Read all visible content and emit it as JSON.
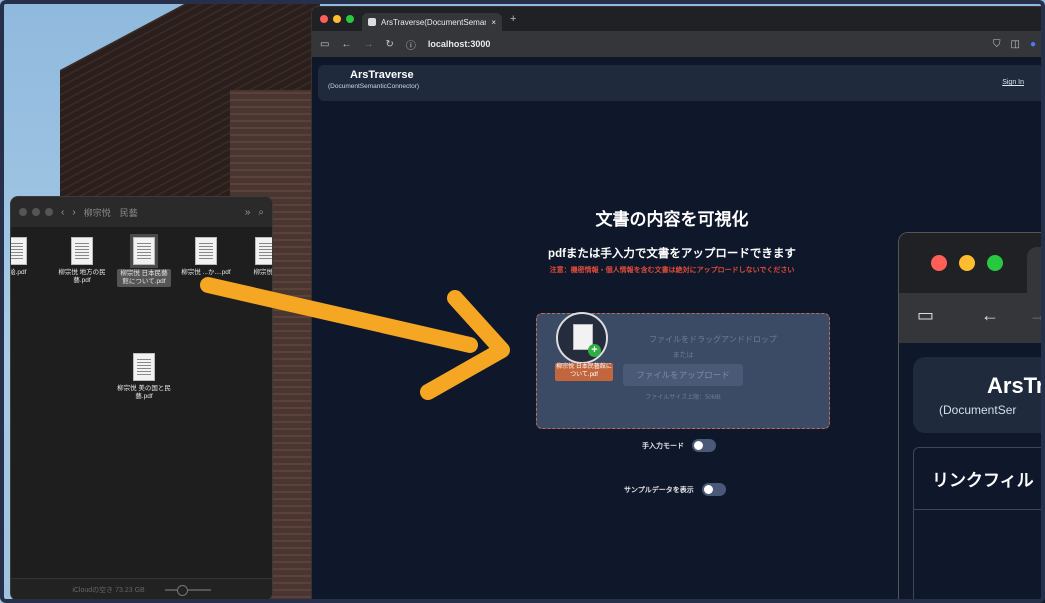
{
  "finder": {
    "title": "柳宗悦　民藝",
    "files": [
      {
        "name": "..絵.pdf"
      },
      {
        "name": "柳宗悦 地方の民藝.pdf"
      },
      {
        "name": "柳宗悦 日本民藝館について.pdf"
      },
      {
        "name": "柳宗悦 ...か....pdf"
      },
      {
        "name": "柳宗悦..."
      },
      {
        "name": "柳宗悦 美の国と民藝.pdf"
      }
    ],
    "footer": "iCloudの空き 73.23 GB"
  },
  "browser": {
    "tab_title": "ArsTraverse(DocumentSeman",
    "new_tab": "+",
    "url": "localhost:3000",
    "brand_title": "ArsTraverse",
    "brand_subtitle": "(DocumentSemanticConnector)",
    "signin": "Sign In"
  },
  "main": {
    "title": "文書の内容を可視化",
    "subtitle": "pdfまたは手入力で文書をアップロードできます",
    "warning": "注意：機密情報・個人情報を含む文書は絶対にアップロードしないでください",
    "dropzone": {
      "drag_text": "ファイルをドラッグアンドドロップ",
      "or_text": "または",
      "upload_button": "ファイルをアップロード",
      "size_limit": "ファイルサイズ上限：50MB"
    },
    "manual_mode_label": "手入力モード",
    "sample_label": "サンプルデータを表示"
  },
  "drag_item": {
    "label": "柳宗悦 日本民藝館について.pdf"
  },
  "browser2": {
    "brand_title": "ArsTr",
    "brand_subtitle": "(DocumentSer",
    "panel_title": "リンクフィル"
  },
  "colors": {
    "background": "#0f172a",
    "warning": "#e04b3a",
    "arrow": "#f5a623",
    "drag_label": "#c2663e"
  }
}
